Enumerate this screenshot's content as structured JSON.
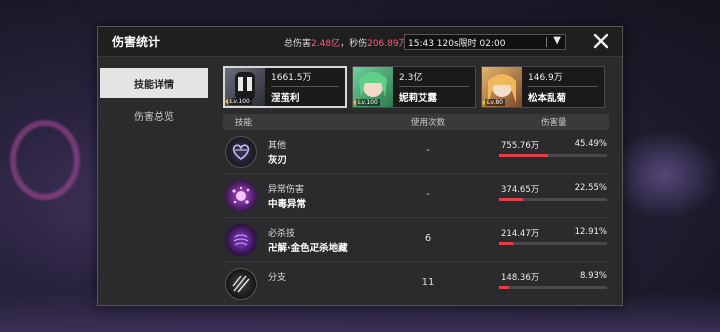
{
  "window": {
    "title": "伤害统计",
    "total_label": "总伤害",
    "total_value": "2.48亿",
    "dps_label": "秒伤",
    "dps_value": "206.89万/s",
    "time_filter": "15:43 120s限时 02:00"
  },
  "sidebar": {
    "tabs": [
      {
        "label": "技能详情",
        "active": true
      },
      {
        "label": "伤害总览",
        "active": false
      }
    ]
  },
  "characters": [
    {
      "damage": "1661.5万",
      "name": "涅茧利",
      "level": "Lv.100",
      "selected": true
    },
    {
      "damage": "2.3亿",
      "name": "妮莉艾露",
      "level": "Lv.100",
      "selected": false
    },
    {
      "damage": "146.9万",
      "name": "松本乱菊",
      "level": "Lv.80",
      "selected": false
    }
  ],
  "table": {
    "headers": {
      "skill": "技能",
      "uses": "使用次数",
      "damage": "伤害量"
    },
    "rows": [
      {
        "category": "其他",
        "name": "灰刃",
        "uses": "-",
        "damage": "755.76万",
        "percent": "45.49%",
        "fraction": 0.4549,
        "icon": "heart-wing-icon"
      },
      {
        "category": "异常伤害",
        "name": "中毒异常",
        "uses": "-",
        "damage": "374.65万",
        "percent": "22.55%",
        "fraction": 0.2255,
        "icon": "poison-splat-icon"
      },
      {
        "category": "必杀技",
        "name": "卍解·金色疋杀地藏",
        "uses": "6",
        "damage": "214.47万",
        "percent": "12.91%",
        "fraction": 0.1291,
        "icon": "purple-orb-icon"
      },
      {
        "category": "分支",
        "name": "",
        "uses": "11",
        "damage": "148.36万",
        "percent": "8.93%",
        "fraction": 0.0893,
        "icon": "claw-slash-icon"
      }
    ]
  },
  "colors": {
    "accent": "#ff5a7a",
    "bar": "#e0404a"
  }
}
